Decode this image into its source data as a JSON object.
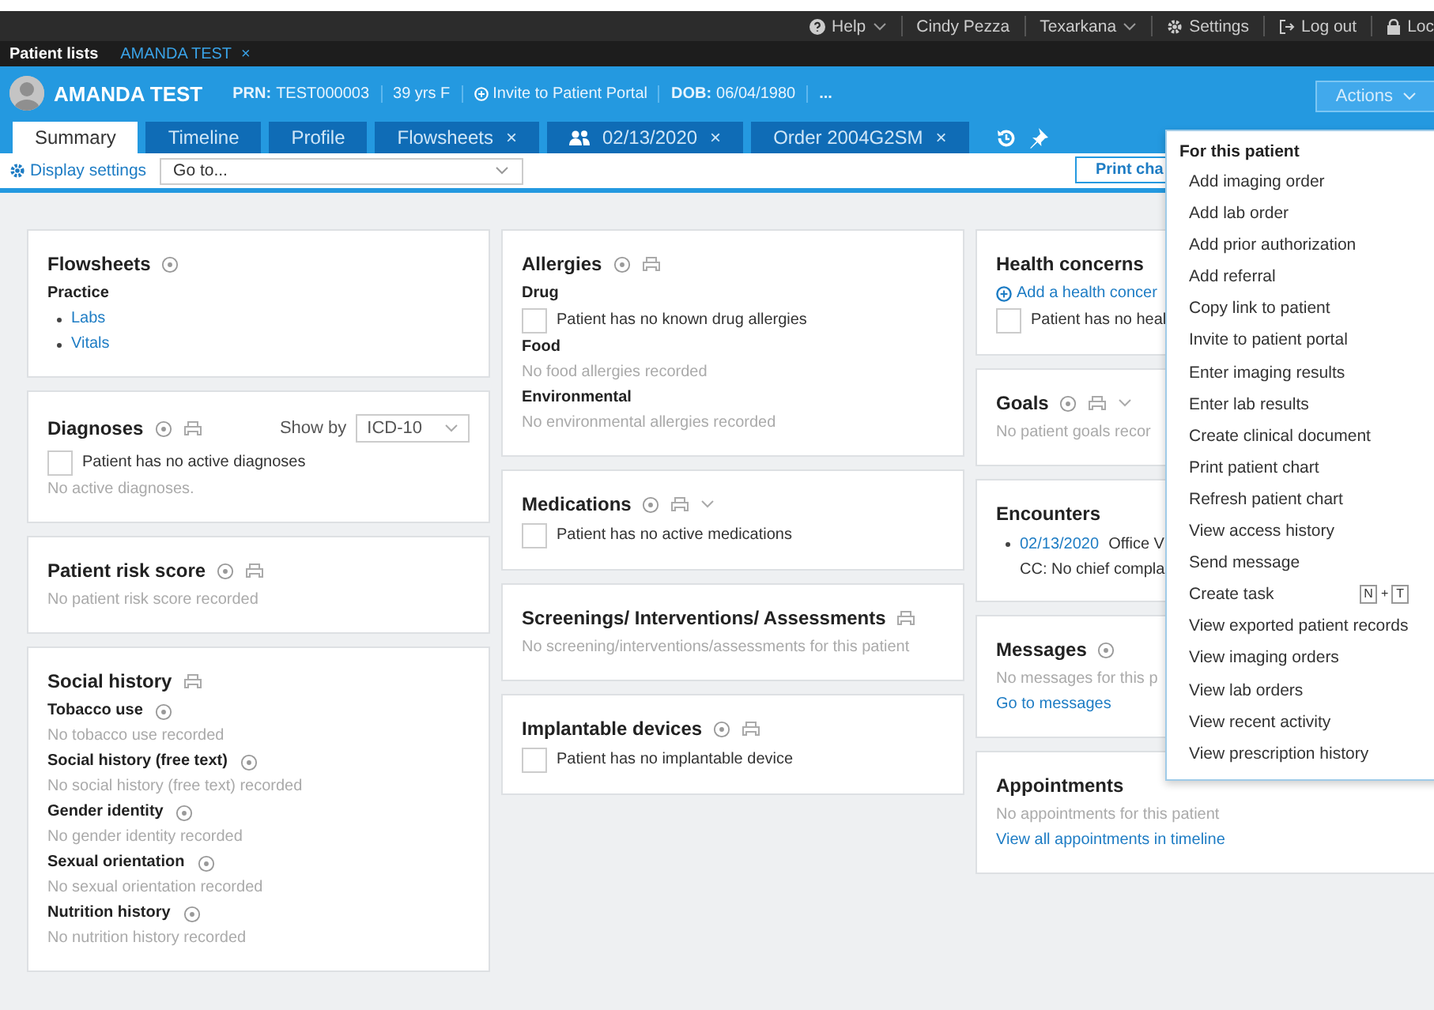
{
  "top_bar": {
    "help": "Help",
    "user": "Cindy Pezza",
    "location": "Texarkana",
    "settings": "Settings",
    "logout": "Log out",
    "lock": "Loc"
  },
  "patient_tabs": [
    {
      "label": "Patient lists",
      "selected": false
    },
    {
      "label": "AMANDA TEST",
      "close": "×",
      "selected": true
    }
  ],
  "patient_header": {
    "name": "AMANDA TEST",
    "prn_label": "PRN:",
    "prn": "TEST000003",
    "age": "39 yrs F",
    "portal": "Invite to Patient Portal",
    "dob_label": "DOB:",
    "dob": "06/04/1980",
    "more": "...",
    "actions": "Actions"
  },
  "chart_tabs": [
    {
      "label": "Summary",
      "selected": true
    },
    {
      "label": "Timeline",
      "selected": false
    },
    {
      "label": "Profile",
      "selected": false
    },
    {
      "label": "Flowsheets",
      "close": "×",
      "selected": false
    },
    {
      "label": "02/13/2020",
      "close": "×",
      "kind": "encounter",
      "selected": false
    },
    {
      "label": "Order 2004G2SM",
      "close": "×",
      "selected": false
    }
  ],
  "toolbar": {
    "display_settings": "Display settings",
    "goto": "Go to...",
    "print": "Print cha"
  },
  "columns": [
    {
      "cards": [
        {
          "title": "Flowsheets",
          "info": true,
          "body": [
            {
              "kind": "subheading",
              "text": "Practice"
            },
            {
              "kind": "bullet_link",
              "text": "Labs"
            },
            {
              "kind": "bullet_link",
              "text": "Vitals"
            }
          ]
        },
        {
          "title": "Diagnoses",
          "info": true,
          "print": true,
          "show_by": {
            "label": "Show by",
            "value": "ICD-10"
          },
          "body": [
            {
              "kind": "checkbox",
              "text": "Patient has no active diagnoses",
              "checked": false
            },
            {
              "kind": "empty",
              "text": "No active diagnoses."
            }
          ]
        },
        {
          "title": "Patient risk score",
          "info": true,
          "print": true,
          "body": [
            {
              "kind": "empty",
              "text": "No patient risk score recorded"
            }
          ]
        },
        {
          "title": "Social history",
          "print": true,
          "body": [
            {
              "kind": "subheading",
              "text": "Tobacco use",
              "info": true
            },
            {
              "kind": "empty",
              "text": "No tobacco use recorded"
            },
            {
              "kind": "subheading",
              "text": "Social history (free text)",
              "info": true
            },
            {
              "kind": "empty",
              "text": "No social history (free text) recorded"
            },
            {
              "kind": "subheading",
              "text": "Gender identity",
              "info": true
            },
            {
              "kind": "empty",
              "text": "No gender identity recorded"
            },
            {
              "kind": "subheading",
              "text": "Sexual orientation",
              "info": true
            },
            {
              "kind": "empty",
              "text": "No sexual orientation recorded"
            },
            {
              "kind": "subheading",
              "text": "Nutrition history",
              "info": true
            },
            {
              "kind": "empty",
              "text": "No nutrition history recorded"
            }
          ]
        }
      ]
    },
    {
      "cards": [
        {
          "title": "Allergies",
          "info": true,
          "print": true,
          "body": [
            {
              "kind": "subheading",
              "text": "Drug"
            },
            {
              "kind": "checkbox",
              "text": "Patient has no known drug allergies",
              "checked": false
            },
            {
              "kind": "subheading",
              "text": "Food"
            },
            {
              "kind": "empty",
              "text": "No food allergies recorded"
            },
            {
              "kind": "subheading",
              "text": "Environmental"
            },
            {
              "kind": "empty",
              "text": "No environmental allergies recorded"
            }
          ]
        },
        {
          "title": "Medications",
          "info": true,
          "print": true,
          "caret": true,
          "body": [
            {
              "kind": "checkbox",
              "text": "Patient has no active medications",
              "checked": false
            }
          ]
        },
        {
          "title": "Screenings/ Interventions/ Assessments",
          "print": true,
          "body": [
            {
              "kind": "empty",
              "text": "No screening/interventions/assessments for this patient"
            }
          ]
        },
        {
          "title": "Implantable devices",
          "info": true,
          "print": true,
          "body": [
            {
              "kind": "checkbox",
              "text": "Patient has no implantable device",
              "checked": false
            }
          ]
        }
      ]
    },
    {
      "cards": [
        {
          "title": "Health concerns",
          "body": [
            {
              "kind": "add_link",
              "text": "Add a health concer"
            },
            {
              "kind": "checkbox",
              "text": "Patient has no heal",
              "checked": false
            }
          ]
        },
        {
          "title": "Goals",
          "info": true,
          "print": true,
          "caret": true,
          "body": [
            {
              "kind": "empty",
              "text": "No patient goals recor"
            }
          ]
        },
        {
          "title": "Encounters",
          "body": [
            {
              "kind": "encounter",
              "date": "02/13/2020",
              "text": "Office V",
              "cc": "CC: No chief compla"
            }
          ]
        },
        {
          "title": "Messages",
          "info": true,
          "body": [
            {
              "kind": "empty",
              "text": "No messages for this p"
            },
            {
              "kind": "link",
              "text": "Go to messages"
            }
          ]
        },
        {
          "title": "Appointments",
          "body": [
            {
              "kind": "empty",
              "text": "No appointments for this patient"
            },
            {
              "kind": "link",
              "text": "View all appointments in timeline"
            }
          ]
        }
      ]
    }
  ],
  "actions_menu": {
    "heading": "For this patient",
    "items": [
      {
        "label": "Add imaging order"
      },
      {
        "label": "Add lab order"
      },
      {
        "label": "Add prior authorization"
      },
      {
        "label": "Add referral"
      },
      {
        "label": "Copy link to patient"
      },
      {
        "label": "Invite to patient portal"
      },
      {
        "label": "Enter imaging results"
      },
      {
        "label": "Enter lab results"
      },
      {
        "label": "Create clinical document"
      },
      {
        "label": "Print patient chart"
      },
      {
        "label": "Refresh patient chart"
      },
      {
        "label": "View access history"
      },
      {
        "label": "Send message"
      },
      {
        "label": "Create task",
        "shortcut": [
          "N",
          "+",
          "T"
        ]
      },
      {
        "label": "View exported patient records"
      },
      {
        "label": "View imaging orders"
      },
      {
        "label": "View lab orders"
      },
      {
        "label": "View recent activity"
      },
      {
        "label": "View prescription history"
      }
    ]
  }
}
